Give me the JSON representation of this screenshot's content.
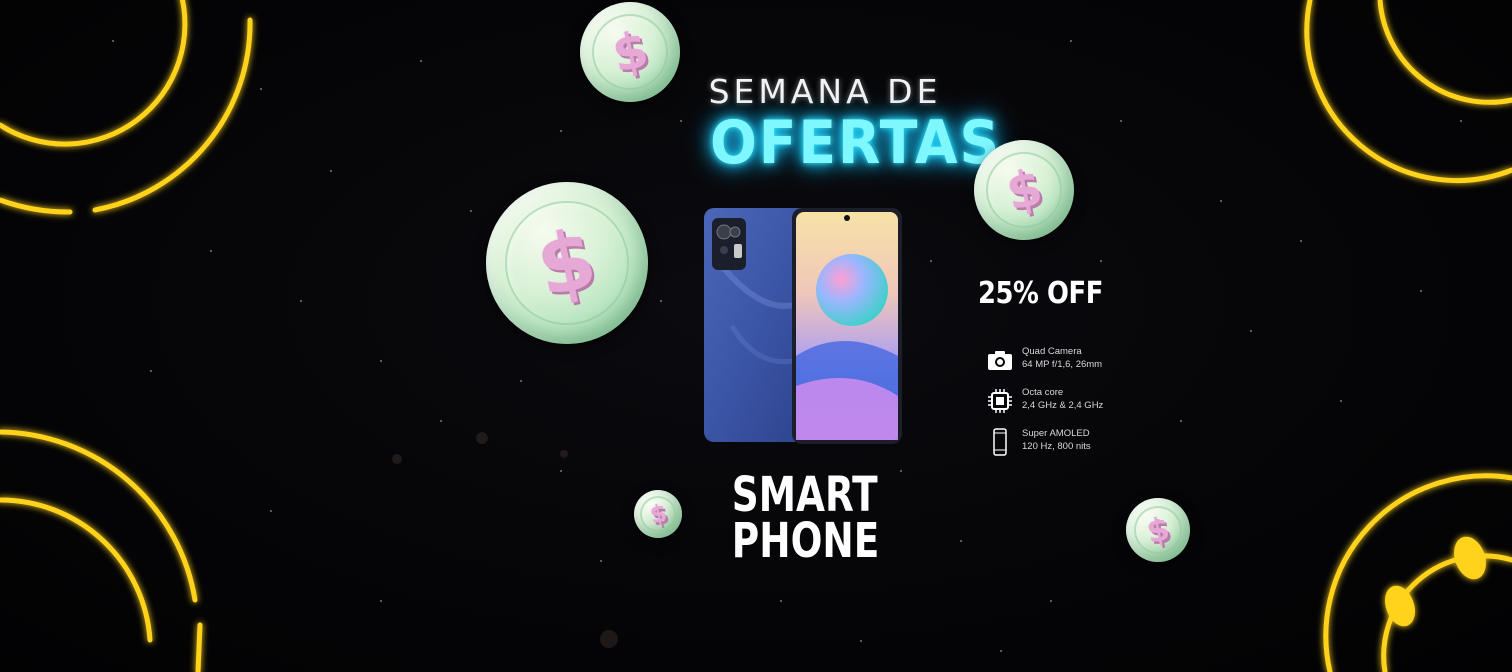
{
  "headline": {
    "top": "SEMANA DE",
    "main": "OFERTAS"
  },
  "product": {
    "line1": "SMART",
    "line2": "PHONE",
    "discount": "25% OFF"
  },
  "specs": [
    {
      "icon": "camera-icon",
      "line1": "Quad Camera",
      "line2": "64 MP f/1,6, 26mm"
    },
    {
      "icon": "cpu-chip-icon",
      "line1": "Octa core",
      "line2": "2,4 GHz & 2,4 GHz"
    },
    {
      "icon": "smartphone-outline-icon",
      "line1": "Super AMOLED",
      "line2": "120 Hz, 800 nits"
    }
  ],
  "coin_symbol": "$",
  "colors": {
    "background": "#050507",
    "neon_cyan": "#7ff7ff",
    "neon_yellow": "#ffd21a",
    "coin_green": "#bfe8c6",
    "coin_symbol_pink": "#e6a8d4",
    "text_white": "#ffffff"
  }
}
